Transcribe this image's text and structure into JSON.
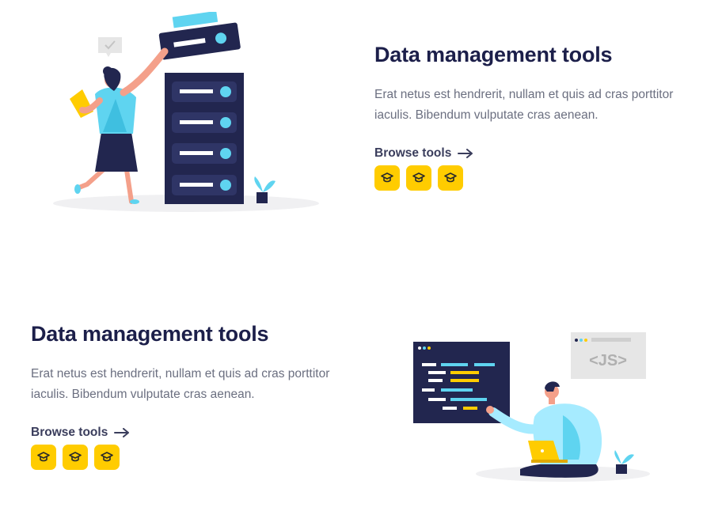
{
  "sections": [
    {
      "title": "Data management tools",
      "description": "Erat netus est hendrerit, nullam et quis ad cras porttitor iaculis. Bibendum vulputate cras aenean.",
      "link_label": "Browse tools",
      "illustration": "woman-server-rack-illustration",
      "badges": [
        {
          "icon": "graduation-cap-icon"
        },
        {
          "icon": "graduation-cap-icon"
        },
        {
          "icon": "graduation-cap-icon"
        }
      ]
    },
    {
      "title": "Data management tools",
      "description": "Erat netus est hendrerit, nullam et quis ad cras porttitor iaculis. Bibendum vulputate cras aenean.",
      "link_label": "Browse tools",
      "illustration": "man-coding-laptop-illustration",
      "code_window_label": "<JS>",
      "badges": [
        {
          "icon": "graduation-cap-icon"
        },
        {
          "icon": "graduation-cap-icon"
        },
        {
          "icon": "graduation-cap-icon"
        }
      ]
    }
  ],
  "colors": {
    "title": "#1c1f4a",
    "body_text": "#6b6f80",
    "badge": "#ffcc00",
    "navy": "#22264f",
    "cyan": "#5fd4f0"
  }
}
